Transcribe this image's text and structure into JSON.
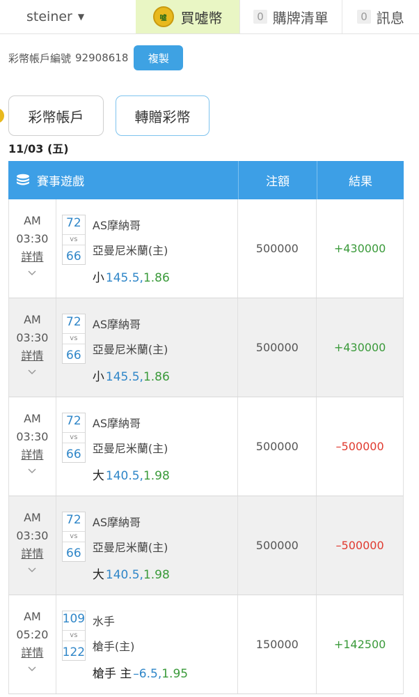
{
  "nav": {
    "username": "steiner",
    "buy_label": "買噓幣",
    "coin_text": "噓",
    "cart_count": "0",
    "cart_label": "購牌清單",
    "msg_count": "0",
    "msg_label": "訊息"
  },
  "account": {
    "label": "彩幣帳戶編號",
    "number": "92908618",
    "copy_label": "複製"
  },
  "buttons": {
    "account": "彩幣帳戶",
    "gift": "轉贈彩幣"
  },
  "date": "11/03 (五)",
  "table": {
    "headers": {
      "game": "賽事遊戲",
      "stake": "注額",
      "result": "結果"
    },
    "rows": [
      {
        "ampm": "AM",
        "time": "03:30",
        "detail": "詳情",
        "score1": "72",
        "vs": "vs",
        "score2": "66",
        "team1": "AS摩納哥",
        "team2": "亞曼尼米蘭(主)",
        "pick": "小",
        "line": "145.5,",
        "odds": "1.86",
        "stake": "500000",
        "result": "+430000",
        "outcome": "win"
      },
      {
        "ampm": "AM",
        "time": "03:30",
        "detail": "詳情",
        "score1": "72",
        "vs": "vs",
        "score2": "66",
        "team1": "AS摩納哥",
        "team2": "亞曼尼米蘭(主)",
        "pick": "小",
        "line": "145.5,",
        "odds": "1.86",
        "stake": "500000",
        "result": "+430000",
        "outcome": "win"
      },
      {
        "ampm": "AM",
        "time": "03:30",
        "detail": "詳情",
        "score1": "72",
        "vs": "vs",
        "score2": "66",
        "team1": "AS摩納哥",
        "team2": "亞曼尼米蘭(主)",
        "pick": "大",
        "line": "140.5,",
        "odds": "1.98",
        "stake": "500000",
        "result": "–500000",
        "outcome": "lose"
      },
      {
        "ampm": "AM",
        "time": "03:30",
        "detail": "詳情",
        "score1": "72",
        "vs": "vs",
        "score2": "66",
        "team1": "AS摩納哥",
        "team2": "亞曼尼米蘭(主)",
        "pick": "大",
        "line": "140.5,",
        "odds": "1.98",
        "stake": "500000",
        "result": "–500000",
        "outcome": "lose"
      },
      {
        "ampm": "AM",
        "time": "05:20",
        "detail": "詳情",
        "score1": "109",
        "vs": "vs",
        "score2": "122",
        "team1": "水手",
        "team2": "槍手(主)",
        "pick": "槍手 主",
        "line": "–6.5,",
        "odds": "1.95",
        "stake": "150000",
        "result": "+142500",
        "outcome": "win"
      }
    ]
  },
  "colors": {
    "header": "#3d9fe6",
    "win": "#3a9a3a",
    "lose": "#e03a2f",
    "accent": "#3ea2e3"
  }
}
